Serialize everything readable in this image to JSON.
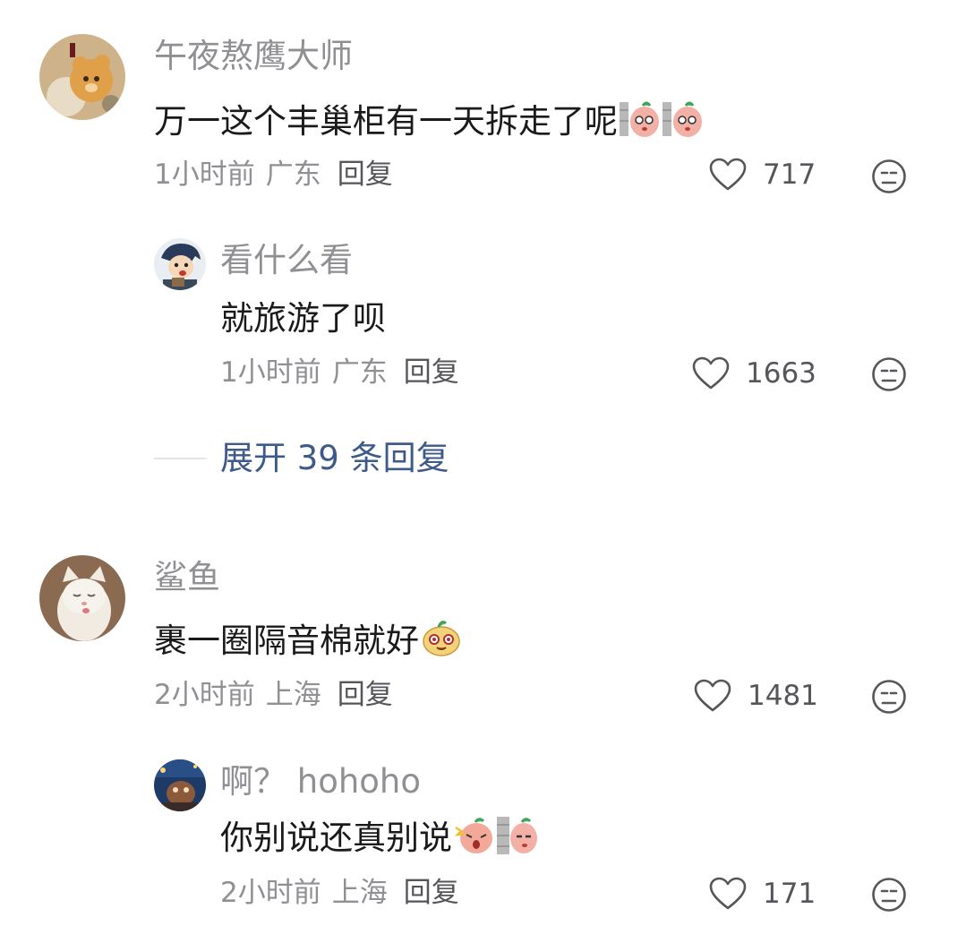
{
  "comments": [
    {
      "user": "午夜熬鹰大师",
      "text": "万一这个丰巢柜有一天拆走了呢",
      "time": "1小时前",
      "location": "广东",
      "reply_label": "回复",
      "likes": "717",
      "emojis": [
        "shy-peach-emoji",
        "shy-peach-emoji"
      ],
      "replies": [
        {
          "user": "看什么看",
          "text": "就旅游了呗",
          "time": "1小时前",
          "location": "广东",
          "reply_label": "回复",
          "likes": "1663"
        }
      ],
      "expand_label": "展开 39 条回复"
    },
    {
      "user": "鲨鱼",
      "text": "裹一圈隔音棉就好",
      "time": "2小时前",
      "location": "上海",
      "reply_label": "回复",
      "likes": "1481",
      "emojis": [
        "smug-face-emoji"
      ],
      "replies": [
        {
          "user": "啊？ hohoho",
          "text": "你别说还真别说",
          "time": "2小时前",
          "location": "上海",
          "reply_label": "回复",
          "likes": "171",
          "emojis": [
            "angry-peach-emoji",
            "peeking-peach-emoji"
          ]
        }
      ]
    }
  ],
  "icons": {
    "like": "heart-outline-icon",
    "dislike": "meh-face-icon"
  },
  "colors": {
    "username": "#8f8f94",
    "text": "#1a1a1a",
    "expand_link": "#3d5a8a"
  }
}
